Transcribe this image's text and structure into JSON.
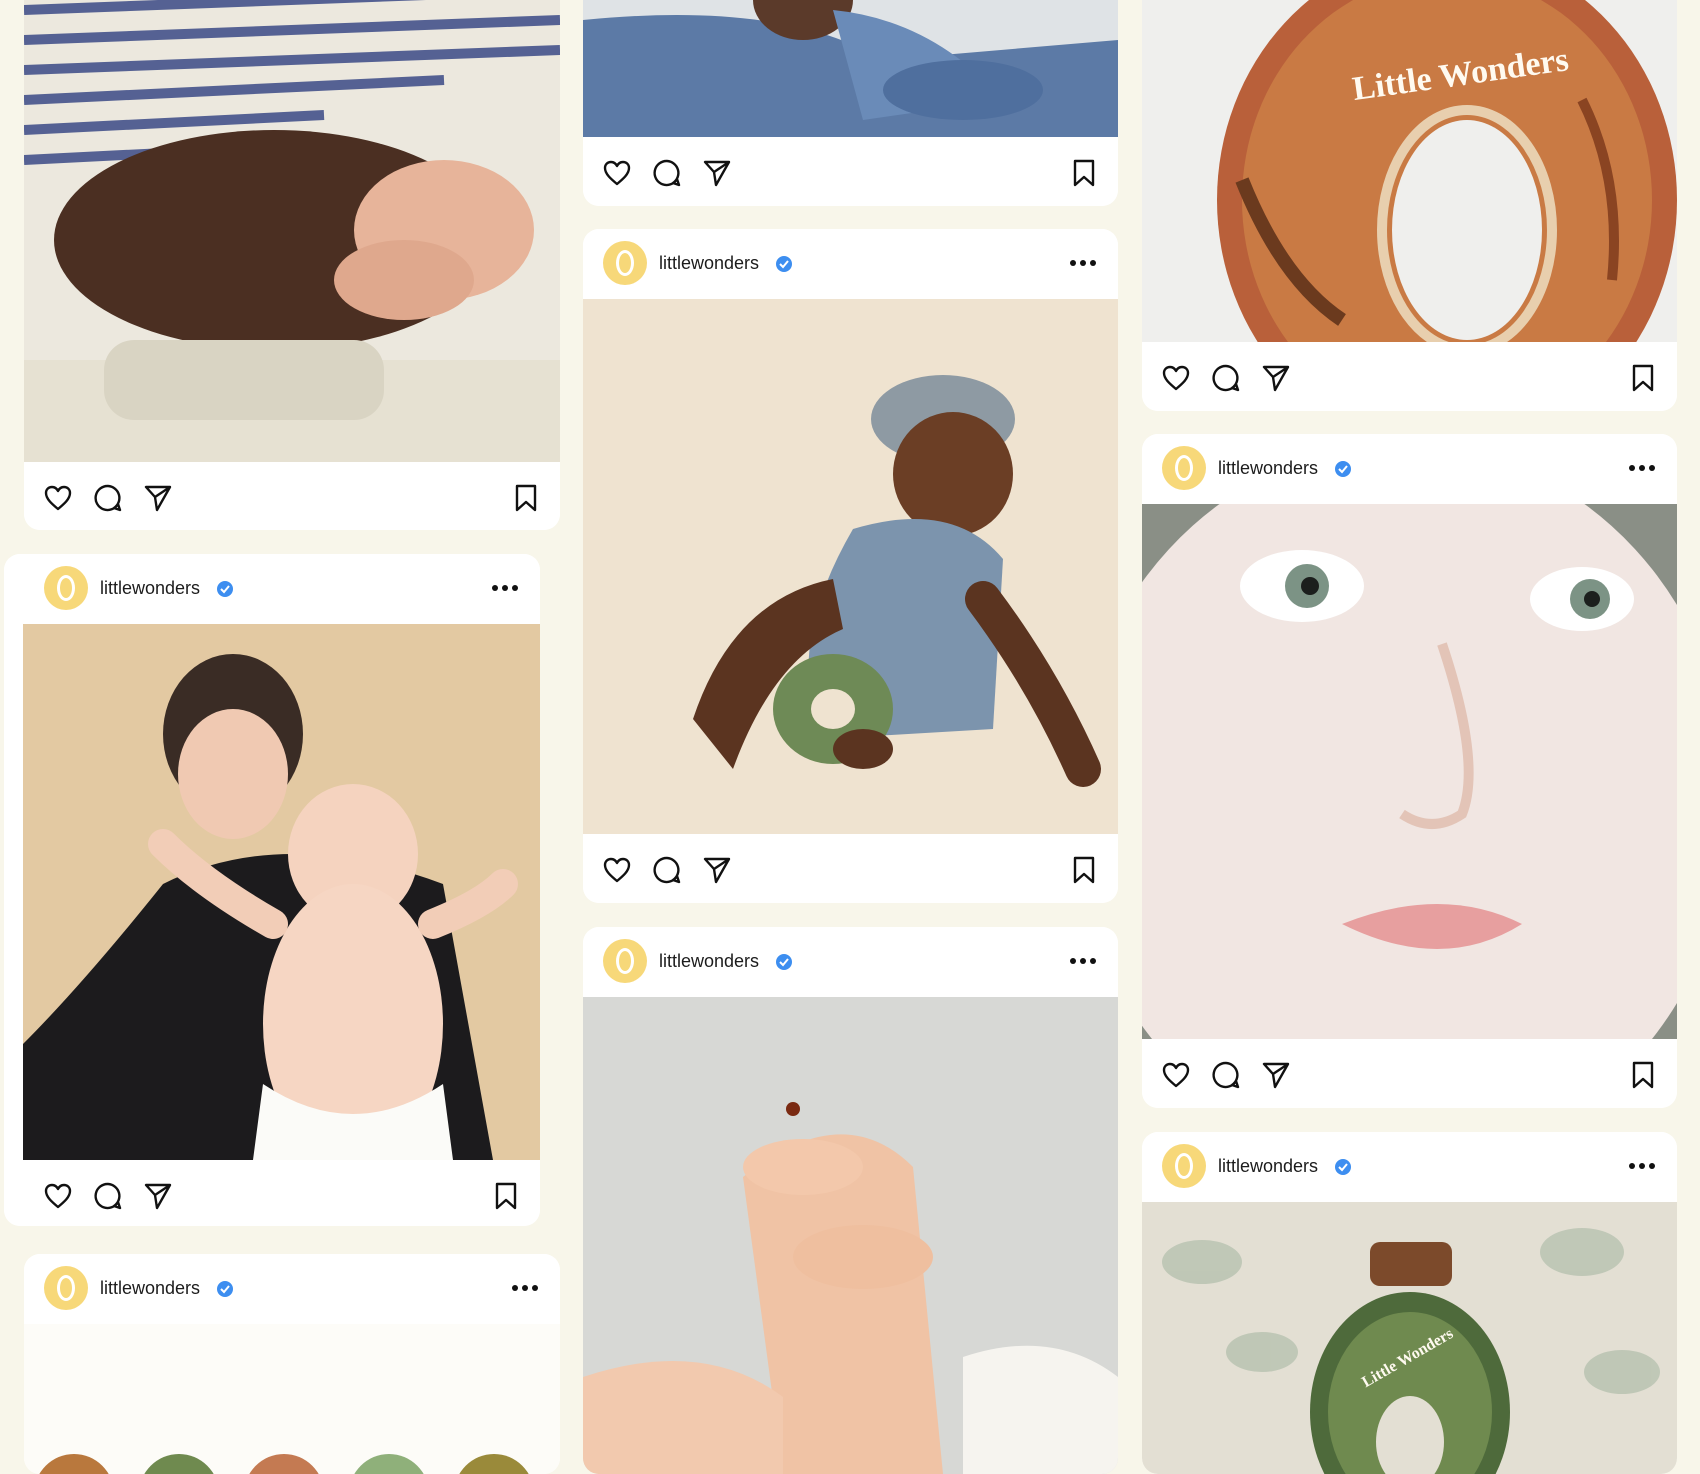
{
  "feed": {
    "brand_color": "#f7d879",
    "verified_color": "#3d8ef0",
    "posts": [
      {
        "username": "littlewonders",
        "image": "parent-hands-holding-baby",
        "icons": [
          "heart-icon",
          "comment-icon",
          "share-icon",
          "bookmark-icon"
        ]
      },
      {
        "username": "littlewonders",
        "image": "mother-holding-smiling-baby"
      },
      {
        "username": "littlewonders",
        "image": "row-of-little-wonders-bottles"
      },
      {
        "username": "littlewonders",
        "image": "baby-in-denim-overalls"
      },
      {
        "username": "littlewonders",
        "image": "toddler-in-overalls-with-ring-bottle"
      },
      {
        "username": "littlewonders",
        "image": "baby-feet-with-ladybug"
      },
      {
        "username": "littlewonders",
        "image": "little-wonders-ring-bottle-closeup",
        "bottle_label": "Little Wonders"
      },
      {
        "username": "littlewonders",
        "image": "baby-face-closeup"
      },
      {
        "username": "littlewonders",
        "image": "little-wonders-bottle-floral",
        "bottle_label": "Little Wonders"
      }
    ]
  }
}
